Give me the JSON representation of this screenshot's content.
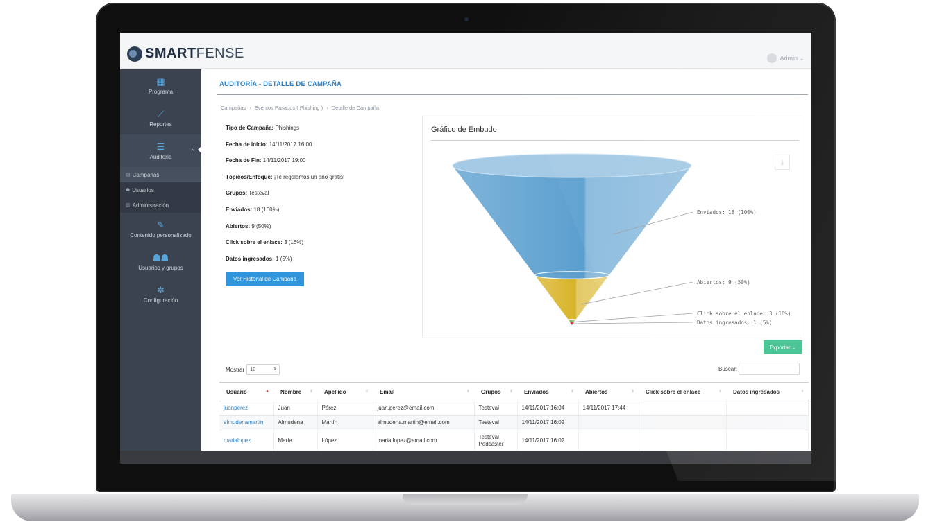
{
  "app": {
    "logo_bold": "SMART",
    "logo_light": "FENSE",
    "user_name": "Admin ⌄"
  },
  "sidebar": {
    "items": [
      {
        "label": "Programa",
        "icon": "calendar-icon"
      },
      {
        "label": "Reportes",
        "icon": "line-chart-icon"
      },
      {
        "label": "Auditoría",
        "icon": "list-icon"
      },
      {
        "label": "Contenido personalizado",
        "icon": "edit-icon"
      },
      {
        "label": "Usuarios y grupos",
        "icon": "users-icon"
      },
      {
        "label": "Configuración",
        "icon": "gear-icon"
      }
    ],
    "subitems": [
      {
        "label": "Campañas"
      },
      {
        "label": "Usuarios"
      },
      {
        "label": "Administración"
      }
    ]
  },
  "page": {
    "title": "AUDITORÍA - DETALLE DE CAMPAÑA",
    "breadcrumb": [
      "Campañas",
      "Eventos Pasados ( Phishing )",
      "Detalle de Campaña"
    ],
    "breadcrumb_sep": "›"
  },
  "details": [
    {
      "label": "Tipo de Campaña:",
      "value": "Phishings"
    },
    {
      "label": "Fecha de Inicio:",
      "value": "14/11/2017 16:00"
    },
    {
      "label": "Fecha de Fin:",
      "value": "14/11/2017 19:00"
    },
    {
      "label": "Tópicos/Enfoque:",
      "value": "¡Te regalamos un año gratis!"
    },
    {
      "label": "Grupos:",
      "value": "Testeval"
    },
    {
      "label": "Enviados:",
      "value": "18 (100%)"
    },
    {
      "label": "Abiertos:",
      "value": "9 (50%)"
    },
    {
      "label": "Click sobre el enlace:",
      "value": "3 (16%)"
    },
    {
      "label": "Datos ingresados:",
      "value": "1 (5%)"
    }
  ],
  "buttons": {
    "history": "Ver Historial de Campaña",
    "export": "Exportar ⌄"
  },
  "chart_title": "Gráfico de Embudo",
  "chart_data": {
    "type": "funnel",
    "title": "Gráfico de Embudo",
    "stages": [
      {
        "name": "Enviados",
        "value": 18,
        "percent": 100,
        "label": "Enviados: 18 (100%)",
        "color": "#5b9fcf"
      },
      {
        "name": "Abiertos",
        "value": 9,
        "percent": 50,
        "label": "Abiertos: 9 (50%)",
        "color": "#d8b42a"
      },
      {
        "name": "Click sobre el enlace",
        "value": 3,
        "percent": 16,
        "label": "Click sobre el enlace: 3 (16%)",
        "color": "#6ea24a"
      },
      {
        "name": "Datos ingresados",
        "value": 1,
        "percent": 5,
        "label": "Datos ingresados: 1 (5%)",
        "color": "#d0404a"
      }
    ]
  },
  "table_controls": {
    "show_label": "Mostrar",
    "show_value": "10",
    "search_label": "Buscar:"
  },
  "table": {
    "headers": [
      "Usuario",
      "Nombre",
      "Apellido",
      "Email",
      "Grupos",
      "Enviados",
      "Abiertos",
      "Click sobre el enlace",
      "Datos ingresados"
    ],
    "rows": [
      {
        "usuario": "juanperez",
        "nombre": "Juan",
        "apellido": "Pérez",
        "email": "juan.perez@email.com",
        "grupos": "Testeval",
        "enviados": "14/11/2017 16:04",
        "abiertos": "14/11/2017 17:44",
        "click": "",
        "datos": ""
      },
      {
        "usuario": "almudenamartin",
        "nombre": "Almudena",
        "apellido": "Martín",
        "email": "almudena.martin@email.com",
        "grupos": "Testeval",
        "enviados": "14/11/2017 16:02",
        "abiertos": "",
        "click": "",
        "datos": ""
      },
      {
        "usuario": "marialopez",
        "nombre": "María",
        "apellido": "López",
        "email": "maria.lopez@email.com",
        "grupos": "Testeval Podcaster",
        "enviados": "14/11/2017 16:02",
        "abiertos": "",
        "click": "",
        "datos": ""
      }
    ]
  }
}
